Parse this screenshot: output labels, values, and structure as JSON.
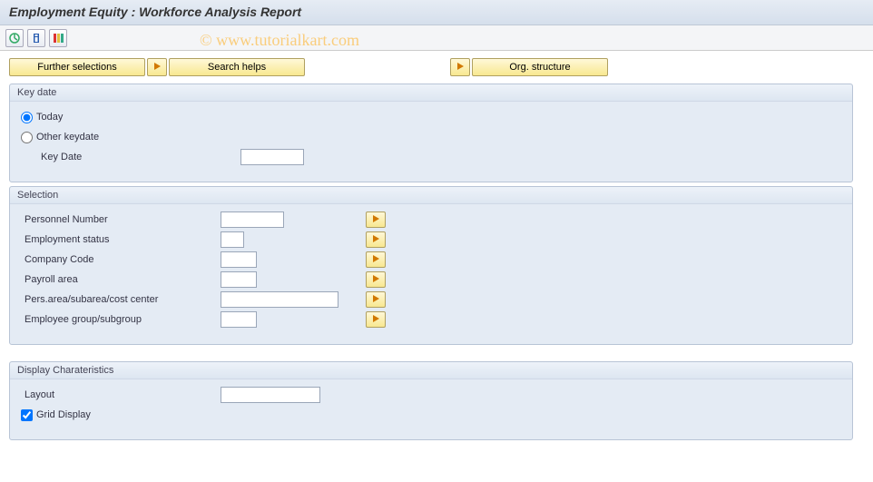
{
  "title": "Employment Equity : Workforce Analysis Report",
  "watermark": "© www.tutorialkart.com",
  "toolbar": {
    "btn_further_selections": "Further selections",
    "btn_search_helps": "Search helps",
    "btn_org_structure": "Org. structure"
  },
  "group_keydate": {
    "title": "Key date",
    "radio_today": "Today",
    "radio_other": "Other keydate",
    "label_keydate": "Key Date",
    "value_keydate": ""
  },
  "group_selection": {
    "title": "Selection",
    "rows": [
      {
        "label": "Personnel Number",
        "value": "",
        "width": "w-med"
      },
      {
        "label": "Employment status",
        "value": "",
        "width": "w-tiny"
      },
      {
        "label": "Company Code",
        "value": "",
        "width": "w-small"
      },
      {
        "label": "Payroll area",
        "value": "",
        "width": "w-small"
      },
      {
        "label": "Pers.area/subarea/cost center",
        "value": "",
        "width": "w-large"
      },
      {
        "label": "Employee group/subgroup",
        "value": "",
        "width": "w-small"
      }
    ]
  },
  "group_display": {
    "title": "Display Charateristics",
    "label_layout": "Layout",
    "value_layout": "",
    "checkbox_grid": "Grid Display",
    "grid_checked": true
  }
}
